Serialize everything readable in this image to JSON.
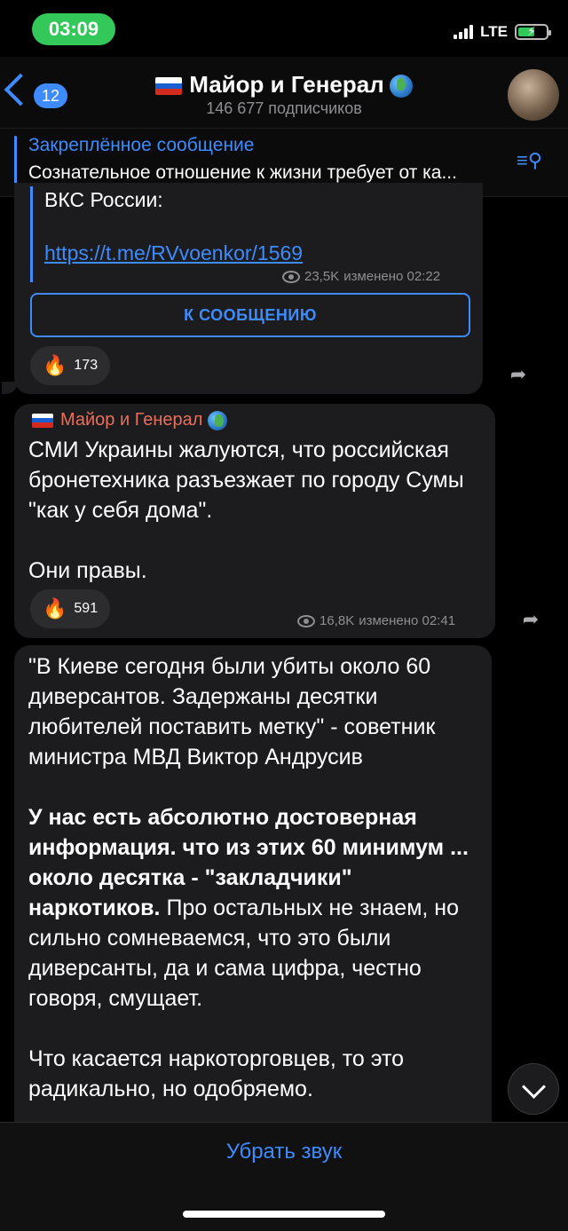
{
  "status_bar": {
    "time": "03:09",
    "network": "LTE"
  },
  "header": {
    "back_count": "12",
    "title": "Майор и Генерал",
    "subscribers": "146 677 подписчиков"
  },
  "pinned": {
    "title": "Закреплённое сообщение",
    "text": "Сознательное отношение к жизни требует от ка..."
  },
  "messages": [
    {
      "quote_text": "ВКС России:",
      "link": "https://t.me/RVvoenkor/1569",
      "views": "23,5K",
      "meta": "изменено 02:22",
      "button_label": "К СООБЩЕНИЮ",
      "reaction_count": "173"
    },
    {
      "sender": "Майор и Генерал",
      "text": "СМИ Украины жалуются, что российская бронетехника разъезжает по городу Сумы \"как у себя дома\".\n\nОни правы.",
      "views": "16,8K",
      "meta": "изменено 02:41",
      "reaction_count": "591"
    },
    {
      "text_part1": "\"В Киеве сегодня были убиты около 60 диверсантов. Задержаны десятки любителей поставить метку\" - советник министра МВД Виктор Андрусив\n\n",
      "text_bold": "У нас есть абсолютно достоверная информация. что из этих 60 минимум ... около десятка - \"закладчики\" наркотиков.",
      "text_part2": " Про остальных не знаем, но сильно сомневаемся, что это были диверсанты, да и сама цифра, честно говоря, смущает.\n\nЧто касается наркоторговцев, то это радикально, но одобряемо."
    }
  ],
  "bottom": {
    "unmute_label": "Убрать звук"
  },
  "colors": {
    "accent": "#3d8bfd",
    "bubble": "#1c1c1e",
    "sender": "#e86f5c",
    "time_pill": "#34c759"
  }
}
